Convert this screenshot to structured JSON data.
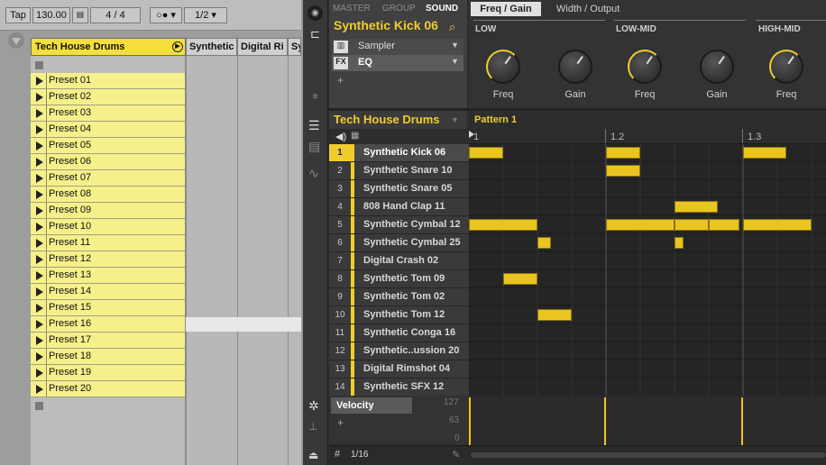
{
  "live": {
    "tap": "Tap",
    "tempo": "130.00",
    "sig_num": "4",
    "sig_sep": "/",
    "sig_den": "4",
    "quant": "1/2",
    "track_name": "Tech House Drums",
    "other_tracks": [
      "Synthetic",
      "Digital Ri",
      "Sy"
    ],
    "clips": [
      "Preset 01",
      "Preset 02",
      "Preset 03",
      "Preset 04",
      "Preset 05",
      "Preset 06",
      "Preset 07",
      "Preset 08",
      "Preset 09",
      "Preset 10",
      "Preset 11",
      "Preset 12",
      "Preset 13",
      "Preset 14",
      "Preset 15",
      "Preset 16",
      "Preset 17",
      "Preset 18",
      "Preset 19",
      "Preset 20"
    ]
  },
  "maschine": {
    "tabs": [
      "MASTER",
      "GROUP",
      "SOUND"
    ],
    "sound_name": "Synthetic Kick 06",
    "plugins": [
      {
        "slot": "sampler",
        "label": "Sampler"
      },
      {
        "slot": "FX",
        "label": "EQ"
      }
    ],
    "add": "+",
    "panel_tabs": [
      "Freq / Gain",
      "Width / Output"
    ],
    "bands": [
      "LOW",
      "LOW-MID",
      "HIGH-MID"
    ],
    "knobs": [
      "Freq",
      "Gain",
      "Freq",
      "Gain",
      "Freq"
    ],
    "group_name": "Tech House Drums",
    "pattern": "Pattern 1",
    "ruler": [
      "1",
      "1.2",
      "1.3"
    ],
    "sounds": [
      {
        "n": "1",
        "name": "Synthetic Kick 06"
      },
      {
        "n": "2",
        "name": "Synthetic Snare 10"
      },
      {
        "n": "3",
        "name": "Synthetic Snare 05"
      },
      {
        "n": "4",
        "name": "808 Hand Clap 11"
      },
      {
        "n": "5",
        "name": "Synthetic Cymbal 12"
      },
      {
        "n": "6",
        "name": "Synthetic Cymbal 25"
      },
      {
        "n": "7",
        "name": "Digital Crash 02"
      },
      {
        "n": "8",
        "name": "Synthetic Tom 09"
      },
      {
        "n": "9",
        "name": "Synthetic Tom 02"
      },
      {
        "n": "10",
        "name": "Synthetic Tom 12"
      },
      {
        "n": "11",
        "name": "Synthetic Conga 16"
      },
      {
        "n": "12",
        "name": "Synthetic..ussion 20"
      },
      {
        "n": "13",
        "name": "Digital Rimshot 04"
      },
      {
        "n": "14",
        "name": "Synthetic SFX 12"
      }
    ],
    "velocity_label": "Velocity",
    "vel_max": "127",
    "vel_mid": "63",
    "vel_min": "0",
    "grid_res": "1/16",
    "accent": "#f0cd2a"
  }
}
